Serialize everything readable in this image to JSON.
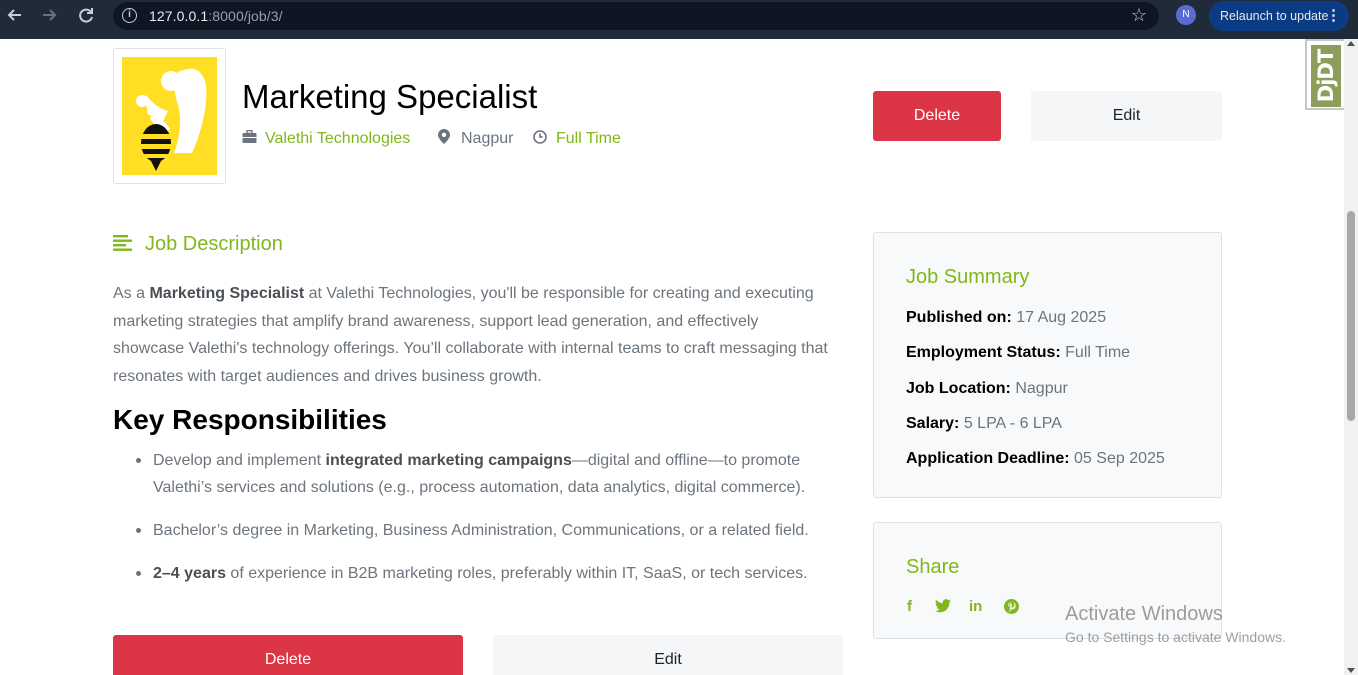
{
  "browser": {
    "url_host": "127.0.0.1",
    "url_path": ":8000/job/3/",
    "profile_initial": "N",
    "relaunch_label": "Relaunch to update"
  },
  "debug_toolbar": {
    "label": "DjDT"
  },
  "job": {
    "title": "Marketing Specialist",
    "company": "Valethi Technologies",
    "location": "Nagpur",
    "type": "Full Time"
  },
  "actions": {
    "delete_label": "Delete",
    "edit_label": "Edit"
  },
  "description": {
    "heading": "Job Description",
    "p_prefix": "As a ",
    "p_bold": "Marketing Specialist",
    "p_rest": " at Valethi Technologies, you'll be responsible for creating and executing marketing strategies that amplify brand awareness, support lead generation, and effectively showcase Valethi's technology offerings. You’ll collaborate with internal teams to craft messaging that resonates with target audiences and drives business growth."
  },
  "responsibilities": {
    "heading": "Key Responsibilities",
    "items": [
      {
        "pre": "Develop and implement ",
        "bold": "integrated marketing campaigns",
        "post": "—digital and offline—to promote Valethi’s services and solutions (e.g., process automation, data analytics, digital commerce)."
      },
      {
        "pre": "Bachelor’s degree in Marketing, Business Administration, Communications, or a related field.",
        "bold": "",
        "post": ""
      },
      {
        "pre": "",
        "bold": "2–4 years",
        "post": " of experience in B2B marketing roles, preferably within IT, SaaS, or tech services."
      }
    ]
  },
  "summary": {
    "heading": "Job Summary",
    "published_label": "Published on:",
    "published_value": "17 Aug 2025",
    "status_label": "Employment Status:",
    "status_value": "Full Time",
    "location_label": "Job Location:",
    "location_value": "Nagpur",
    "salary_label": "Salary:",
    "salary_value": "5 LPA - 6 LPA",
    "deadline_label": "Application Deadline:",
    "deadline_value": "05 Sep 2025"
  },
  "share": {
    "heading": "Share",
    "facebook_glyph": "f",
    "linkedin_glyph": "in"
  },
  "watermark": {
    "line1": "Activate Windows",
    "line2": "Go to Settings to activate Windows."
  },
  "colors": {
    "accent": "#81b71a",
    "danger": "#dc3545",
    "logo_yellow": "#ffde23"
  },
  "icons": [
    "back-arrow-icon",
    "forward-arrow-icon",
    "reload-icon",
    "site-info-icon",
    "star-icon",
    "kebab-menu-icon",
    "briefcase-icon",
    "map-pin-icon",
    "clock-icon",
    "align-left-icon",
    "facebook-icon",
    "twitter-icon",
    "linkedin-icon",
    "pinterest-icon"
  ]
}
